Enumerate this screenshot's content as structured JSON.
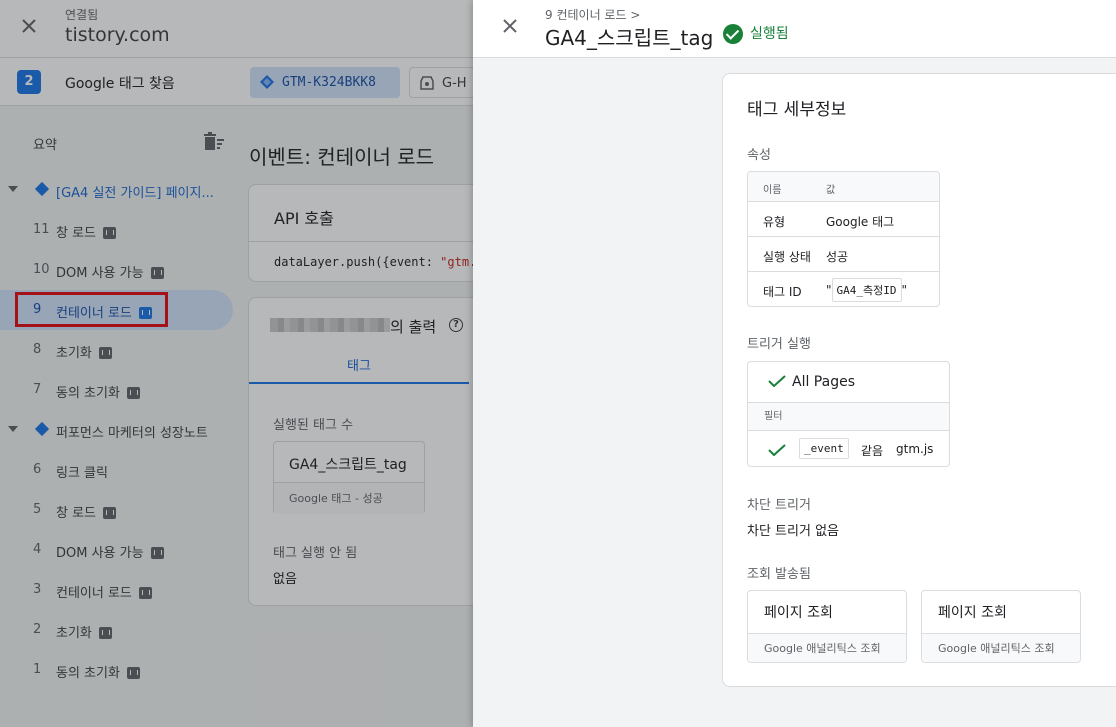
{
  "header": {
    "connected_label": "연결됨",
    "domain": "tistory.com",
    "found_count": "2",
    "found_label": "Google 태그 찾음",
    "containers": [
      "GTM-K324BKK8",
      "G-H"
    ]
  },
  "sidebar": {
    "title": "요약",
    "groups": [
      {
        "label": "[GA4 실전 가이드] 페이지...",
        "items": [
          {
            "num": "11",
            "label": "창 로드"
          },
          {
            "num": "10",
            "label": "DOM 사용 가능"
          },
          {
            "num": "9",
            "label": "컨테이너 로드"
          },
          {
            "num": "8",
            "label": "초기화"
          },
          {
            "num": "7",
            "label": "동의 초기화"
          }
        ]
      },
      {
        "label": "퍼포먼스 마케터의 성장노트",
        "items": [
          {
            "num": "6",
            "label": "링크 클릭"
          },
          {
            "num": "5",
            "label": "창 로드"
          },
          {
            "num": "4",
            "label": "DOM 사용 가능"
          },
          {
            "num": "3",
            "label": "컨테이너 로드"
          },
          {
            "num": "2",
            "label": "초기화"
          },
          {
            "num": "1",
            "label": "동의 초기화"
          }
        ]
      }
    ]
  },
  "main": {
    "event_title": "이벤트: 컨테이너 로드",
    "api_title": "API 호출",
    "api_code_prefix": "dataLayer.push({event: ",
    "api_code_value": "\"gtm.js",
    "output_suffix": "의 출력",
    "tab_label": "태그",
    "fired_label": "실행된 태그 수",
    "fired_tag_name": "GA4_스크립트_tag",
    "fired_tag_sub": "Google 태그 - 성공",
    "not_fired_label": "태그 실행 안 됨",
    "not_fired_value": "없음"
  },
  "drawer": {
    "breadcrumb": "9 컨테이너 로드 >",
    "title": "GA4_스크립트_tag",
    "status": "실행됨",
    "details_title": "태그 세부정보",
    "properties_label": "속성",
    "properties_header": {
      "name": "이름",
      "value": "값"
    },
    "properties": [
      {
        "name": "유형",
        "value": "Google 태그"
      },
      {
        "name": "실행 상태",
        "value": "성공"
      }
    ],
    "tag_id_label": "태그 ID",
    "tag_id_quote_open": "\"",
    "tag_id_var": "GA4_측정ID",
    "tag_id_quote_close": "\"",
    "triggers_label": "트리거 실행",
    "trigger_name": "All Pages",
    "filter_label": "필터",
    "filter_var": "_event",
    "filter_op": "같음",
    "filter_value": "gtm.js",
    "blocking_label": "차단 트리거",
    "blocking_value": "차단 트리거 없음",
    "hits_label": "조회 발송됨",
    "hits": [
      {
        "name": "페이지 조회",
        "sub": "Google 애널리틱스 조회"
      },
      {
        "name": "페이지 조회",
        "sub": "Google 애널리틱스 조회"
      }
    ]
  },
  "colors": {
    "accent": "#1a73e8",
    "success": "#188038",
    "highlight_box": "#e50914"
  }
}
